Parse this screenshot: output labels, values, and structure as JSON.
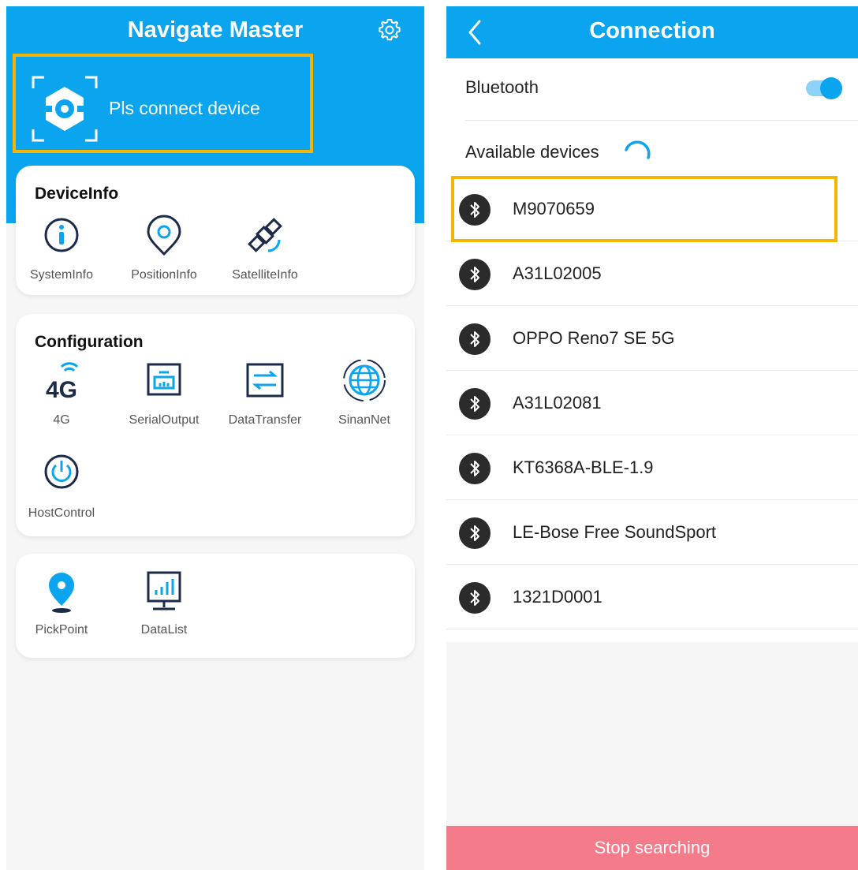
{
  "left": {
    "app_title": "Navigate Master",
    "connect_text": "Pls connect device",
    "device_info": {
      "title": "DeviceInfo",
      "items": [
        {
          "label": "SystemInfo",
          "icon": "info-icon"
        },
        {
          "label": "PositionInfo",
          "icon": "location-pin-icon"
        },
        {
          "label": "SatelliteInfo",
          "icon": "satellite-icon"
        }
      ]
    },
    "configuration": {
      "title": "Configuration",
      "items": [
        {
          "label": "4G",
          "icon": "4g-signal-icon",
          "glyph": "4G"
        },
        {
          "label": "SerialOutput",
          "icon": "serial-port-icon"
        },
        {
          "label": "DataTransfer",
          "icon": "data-transfer-icon"
        },
        {
          "label": "SinanNet",
          "icon": "globe-network-icon"
        },
        {
          "label": "HostControl",
          "icon": "power-icon"
        }
      ]
    },
    "tools": {
      "items": [
        {
          "label": "PickPoint",
          "icon": "map-pin-icon"
        },
        {
          "label": "DataList",
          "icon": "bar-chart-monitor-icon"
        }
      ]
    },
    "colors": {
      "primary": "#0aa5ee",
      "highlight": "#f5b400",
      "background": "#f6f6f6"
    }
  },
  "right": {
    "title": "Connection",
    "bluetooth_label": "Bluetooth",
    "bluetooth_enabled": true,
    "available_label": "Available devices",
    "devices": [
      "M9070659",
      "A31L02005",
      "OPPO Reno7 SE 5G",
      "A31L02081",
      "KT6368A-BLE-1.9",
      "LE-Bose Free SoundSport",
      "1321D0001"
    ],
    "stop_button": "Stop searching",
    "colors": {
      "stop_button": "#f47b8a",
      "device_icon": "#2b2b2b"
    }
  }
}
